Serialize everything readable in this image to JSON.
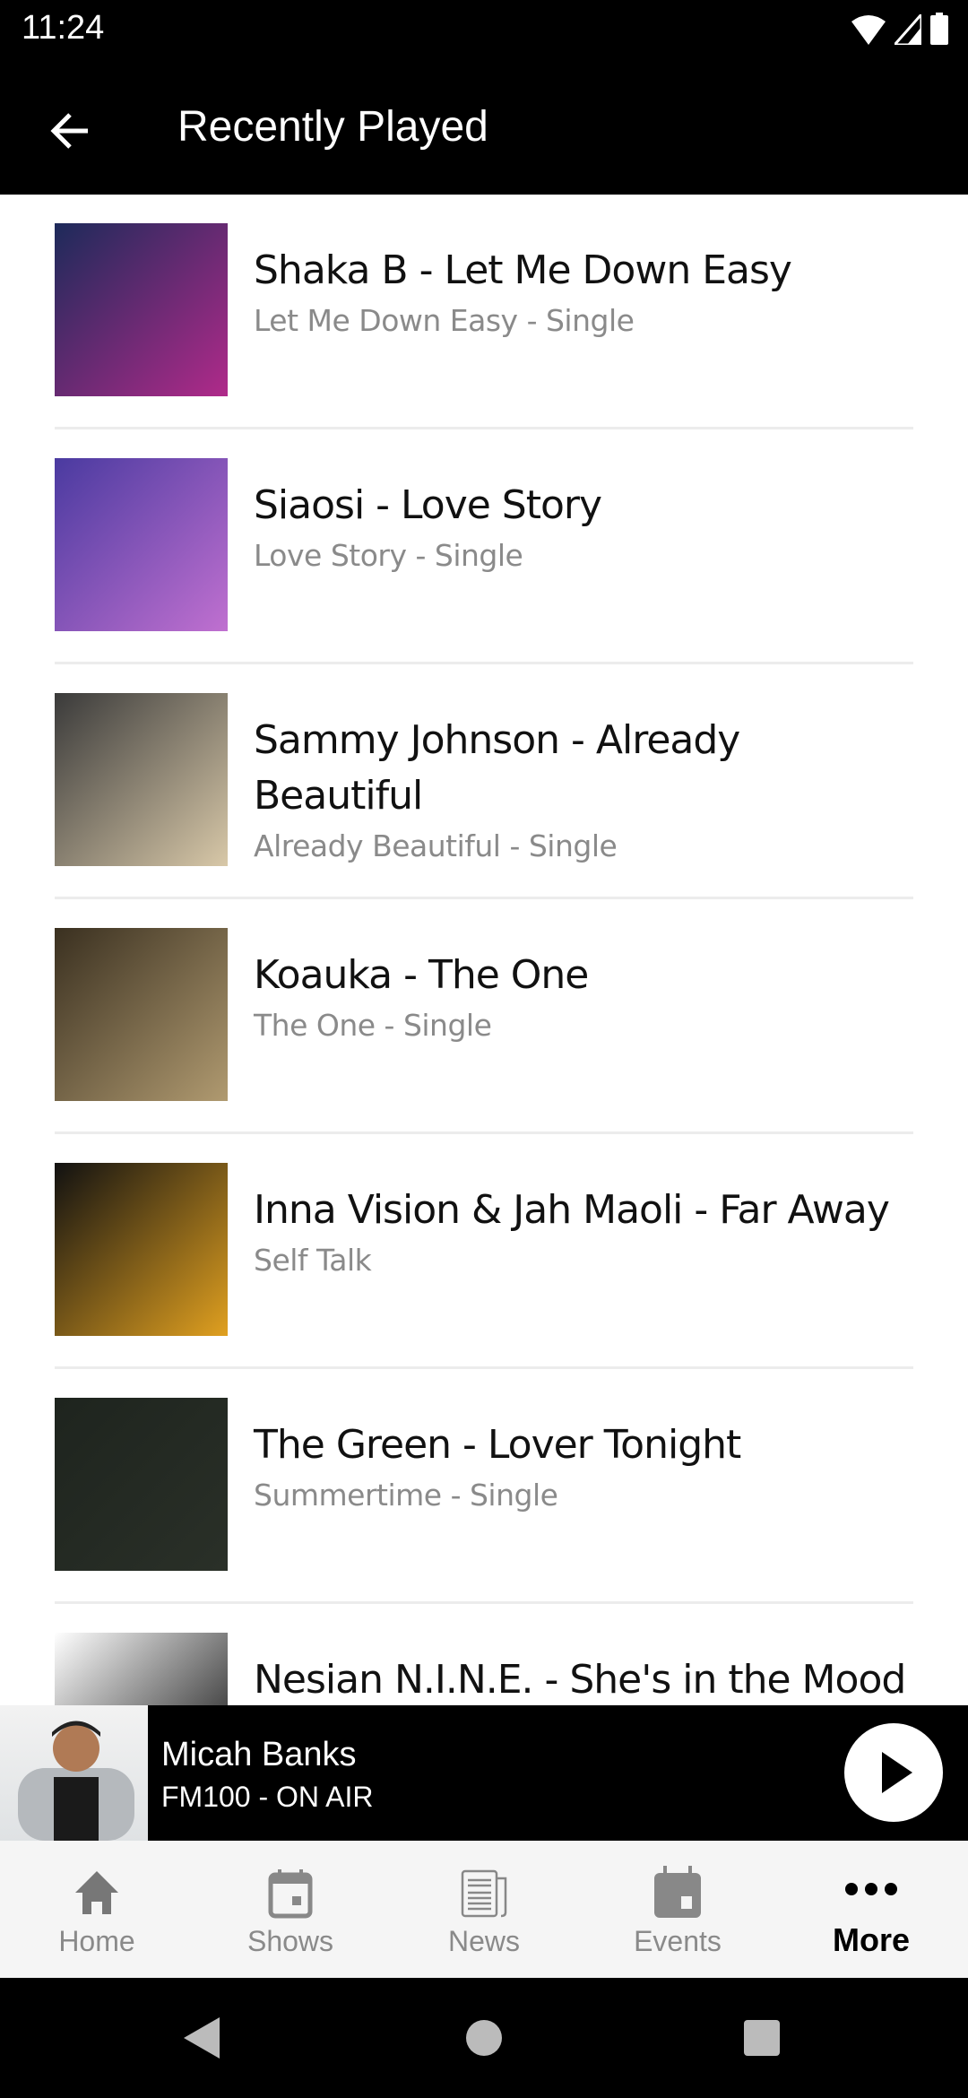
{
  "status": {
    "time": "11:24"
  },
  "appbar": {
    "title": "Recently Played",
    "back_icon": "arrow-left-icon"
  },
  "tracks": [
    {
      "title": "Shaka B - Let Me Down Easy",
      "subtitle": "Let Me Down Easy - Single",
      "art": [
        "#1d2a5a",
        "#b02a8a"
      ]
    },
    {
      "title": "Siaosi - Love Story",
      "subtitle": "Love Story - Single",
      "art": [
        "#4a3aa0",
        "#c070d0"
      ]
    },
    {
      "title": "Sammy Johnson - Already Beautiful",
      "subtitle": "Already Beautiful - Single",
      "art": [
        "#3a3a3a",
        "#d8c8a8"
      ]
    },
    {
      "title": "Koauka - The One",
      "subtitle": "The One - Single",
      "art": [
        "#3a3020",
        "#b09a70"
      ]
    },
    {
      "title": "Inna Vision & Jah Maoli - Far Away",
      "subtitle": "Self Talk",
      "art": [
        "#111111",
        "#e0a020"
      ]
    },
    {
      "title": "The Green - Lover Tonight",
      "subtitle": "Summertime - Single",
      "art": [
        "#1e241e",
        "#2a3028"
      ]
    },
    {
      "title": "Nesian N.I.N.E. - She's in the Mood",
      "subtitle": "",
      "art": [
        "#ffffff",
        "#000000"
      ]
    }
  ],
  "player": {
    "name": "Micah Banks",
    "station": "FM100 - ON AIR",
    "play_icon": "play-icon"
  },
  "nav": {
    "items": [
      {
        "label": "Home",
        "icon": "home-icon"
      },
      {
        "label": "Shows",
        "icon": "calendar-icon"
      },
      {
        "label": "News",
        "icon": "newspaper-icon"
      },
      {
        "label": "Events",
        "icon": "calendar-icon"
      },
      {
        "label": "More",
        "icon": "more-dots-icon",
        "active": true
      }
    ]
  }
}
